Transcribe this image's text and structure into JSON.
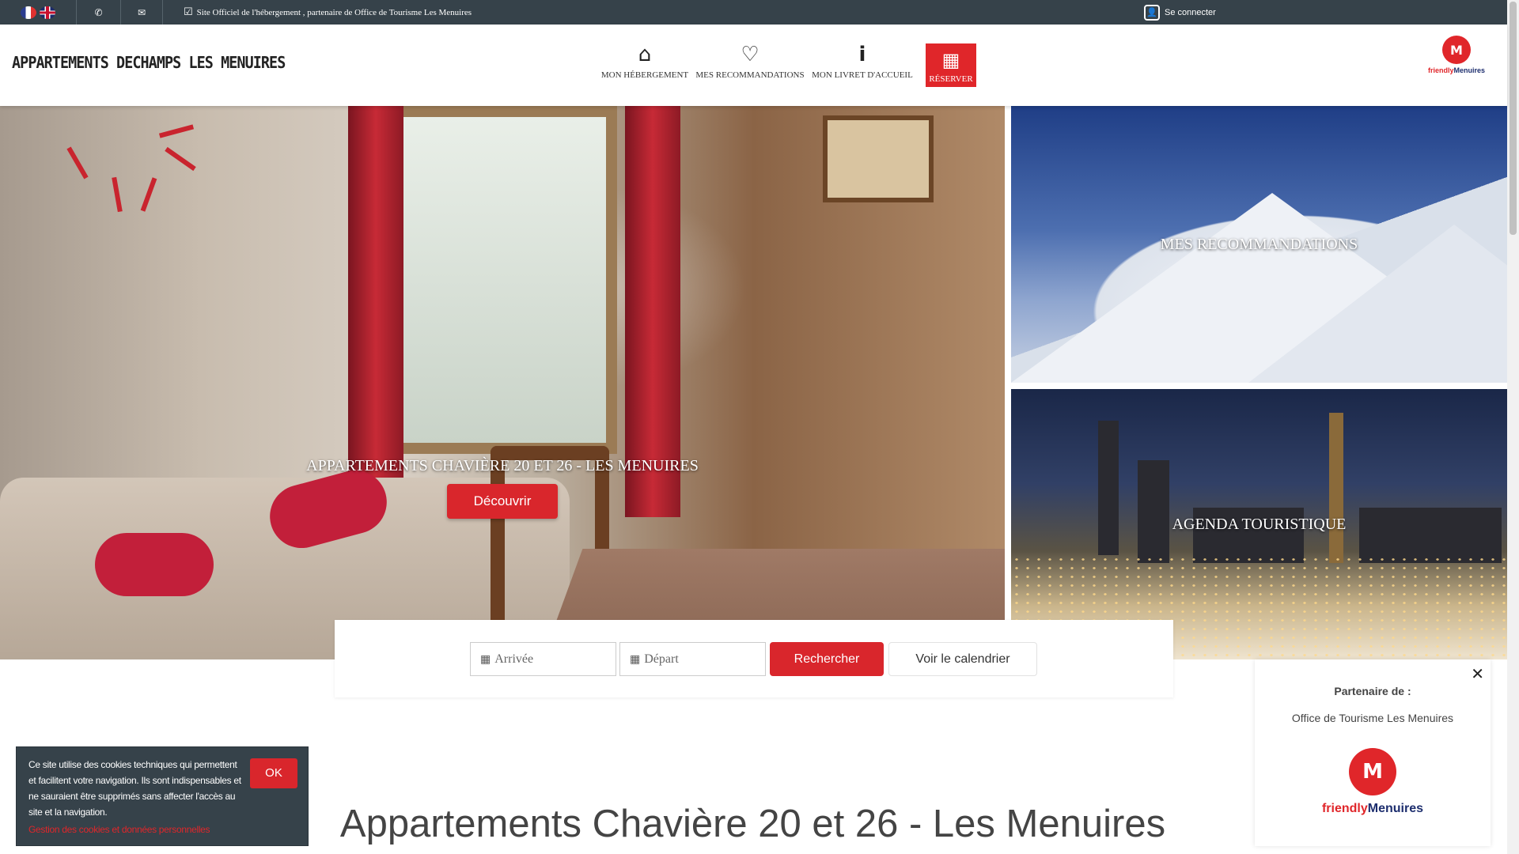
{
  "topbar": {
    "official_text": "Site Officiel de l'hébergement , partenaire de Office de Tourisme Les Menuires",
    "login_label": "Se connecter",
    "icons": [
      "flag-fr-icon",
      "flag-en-icon",
      "phone-icon",
      "envelope-icon",
      "check-square-icon",
      "user-icon"
    ]
  },
  "header": {
    "brand": "APPARTEMENTS DECHAMPS LES MENUIRES",
    "nav": [
      {
        "label": "MON HÉBERGEMENT",
        "icon": "home-icon"
      },
      {
        "label": "MES RECOMMANDATIONS",
        "icon": "heart-icon"
      },
      {
        "label": "MON LIVRET D'ACCUEIL",
        "icon": "info-icon"
      },
      {
        "label": "RÉSERVER",
        "icon": "calendar-icon"
      }
    ],
    "logo_brand": {
      "friendly": "friendly",
      "menuires": "Menuires"
    }
  },
  "hero": {
    "title": "APPARTEMENTS CHAVIÈRE 20 ET 26 - LES MENUIRES",
    "button": "Découvrir"
  },
  "tiles": {
    "recommendations": "MES RECOMMANDATIONS",
    "agenda": "AGENDA TOURISTIQUE",
    "copyright": "©friendly.jpg"
  },
  "search": {
    "arrival_placeholder": "Arrivée",
    "departure_placeholder": "Départ",
    "search_button": "Rechercher",
    "calendar_button": "Voir le calendrier"
  },
  "page_title": "Appartements Chavière 20 et 26 - Les Menuires",
  "partner": {
    "title": "Partenaire de :",
    "name": "Office de Tourisme Les Menuires",
    "logo_friendly": "friendly",
    "logo_menuires": "Menuires"
  },
  "cookie": {
    "text": "Ce site utilise des cookies techniques qui permettent et facilitent votre navigation. Ils sont indispensables et ne sauraient être supprimés sans affecter l'accès au site et la navigation.",
    "link": "Gestion des cookies et données personnelles",
    "ok": "OK"
  },
  "colors": {
    "accent_red": "#d9262c",
    "topbar": "#36424a",
    "brand_blue": "#1d2e6e"
  }
}
